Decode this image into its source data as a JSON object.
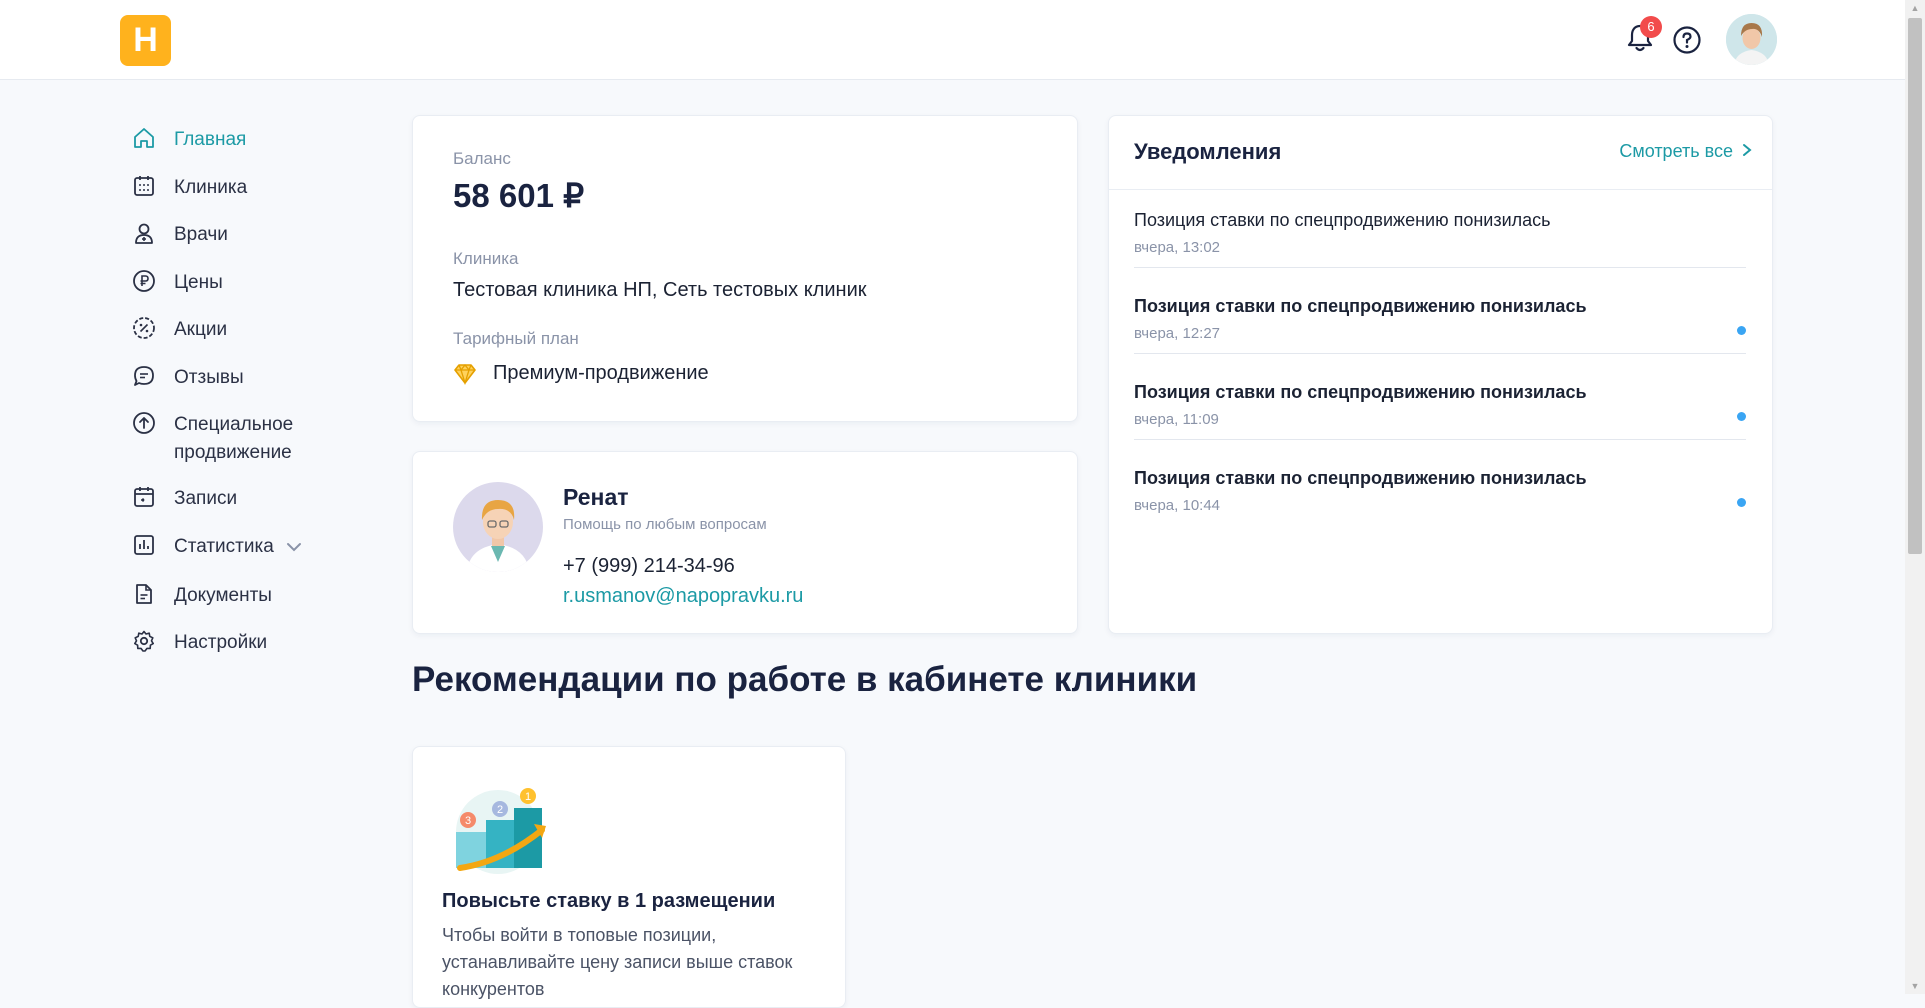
{
  "header": {
    "logo_letter": "H",
    "notifications_count": "6",
    "accent_color": "#ffb21d"
  },
  "sidebar": {
    "items": [
      {
        "label": "Главная",
        "icon": "home-icon",
        "active": true
      },
      {
        "label": "Клиника",
        "icon": "clinic-icon"
      },
      {
        "label": "Врачи",
        "icon": "doctor-icon"
      },
      {
        "label": "Цены",
        "icon": "ruble-icon"
      },
      {
        "label": "Акции",
        "icon": "percent-icon"
      },
      {
        "label": "Отзывы",
        "icon": "chat-icon"
      },
      {
        "label": "Специальное продвижение",
        "icon": "arrow-up-circle-icon"
      },
      {
        "label": "Записи",
        "icon": "calendar-icon"
      },
      {
        "label": "Статистика",
        "icon": "chart-icon",
        "expandable": true
      },
      {
        "label": "Документы",
        "icon": "document-icon"
      },
      {
        "label": "Настройки",
        "icon": "gear-icon"
      }
    ]
  },
  "balance_card": {
    "balance_label": "Баланс",
    "balance_value": "58 601 ₽",
    "clinic_label": "Клиника",
    "clinic_value": "Тестовая клиника НП, Сеть тестовых клиник",
    "plan_label": "Тарифный план",
    "plan_value": "Премиум-продвижение"
  },
  "manager_card": {
    "name": "Ренат",
    "subtitle": "Помощь по любым вопросам",
    "phone": "+7 (999) 214-34-96",
    "email": "r.usmanov@napopravku.ru"
  },
  "notifications": {
    "title": "Уведомления",
    "view_all": "Смотреть все",
    "items": [
      {
        "text": "Позиция ставки по спецпродвижению понизилась",
        "time": "вчера, 13:02",
        "unread": false
      },
      {
        "text": "Позиция ставки по спецпродвижению понизилась",
        "time": "вчера, 12:27",
        "unread": true
      },
      {
        "text": "Позиция ставки по спецпродвижению понизилась",
        "time": "вчера, 11:09",
        "unread": true
      },
      {
        "text": "Позиция ставки по спецпродвижению понизилась",
        "time": "вчера, 10:44",
        "unread": true
      }
    ]
  },
  "recommendations": {
    "title": "Рекомендации по работе в кабинете клиники",
    "cards": [
      {
        "title": "Повысьте ставку в 1 размещении",
        "text": "Чтобы войти в топовые позиции, устанавливайте цену записи выше ставок конкурентов",
        "illustration_ranks": [
          "3",
          "2",
          "1"
        ]
      }
    ]
  }
}
